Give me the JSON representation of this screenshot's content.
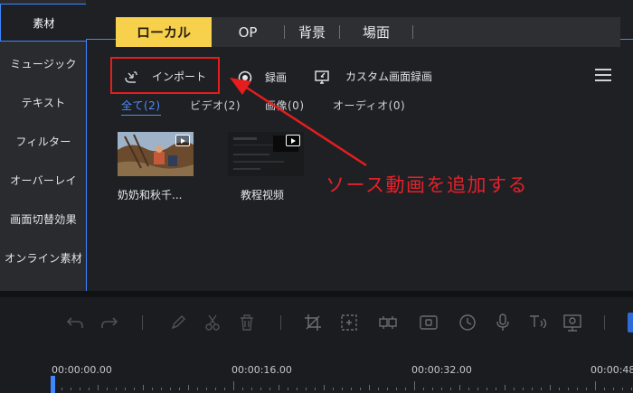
{
  "sidebar": {
    "items": [
      {
        "label": "素材"
      },
      {
        "label": "ミュージック"
      },
      {
        "label": "テキスト"
      },
      {
        "label": "フィルター"
      },
      {
        "label": "オーバーレイ"
      },
      {
        "label": "画面切替効果"
      },
      {
        "label": "オンライン素材"
      }
    ]
  },
  "tabs": [
    {
      "label": "ローカル"
    },
    {
      "label": "OP"
    },
    {
      "label": "背景"
    },
    {
      "label": "場面"
    }
  ],
  "tools": {
    "import_label": "インポート",
    "record_label": "録画",
    "custom_record_label": "カスタム画面録画"
  },
  "filters": [
    {
      "label": "全て(2)"
    },
    {
      "label": "ビデオ(2)"
    },
    {
      "label": "画像(0)"
    },
    {
      "label": "オーディオ(0)"
    }
  ],
  "media": [
    {
      "name": "奶奶和秋千..."
    },
    {
      "name": "教程视频"
    }
  ],
  "annotation": {
    "text": "ソース動画を追加する",
    "color": "#e4212a"
  },
  "toolbar_icons": [
    "undo-icon",
    "redo-icon",
    "pen-icon",
    "scissors-icon",
    "trash-icon",
    "crop-icon",
    "mosaic-icon",
    "split-screen-icon",
    "freeze-frame-icon",
    "speed-icon",
    "microphone-icon",
    "text-to-speech-icon",
    "recorder-icon"
  ],
  "timeline": {
    "times": [
      "00:00:00.00",
      "00:00:16.00",
      "00:00:32.00",
      "00:00:48"
    ]
  },
  "colors": {
    "accent": "#3f86ff",
    "active_tab": "#f7d14c",
    "highlight_red": "#e51d1d"
  }
}
